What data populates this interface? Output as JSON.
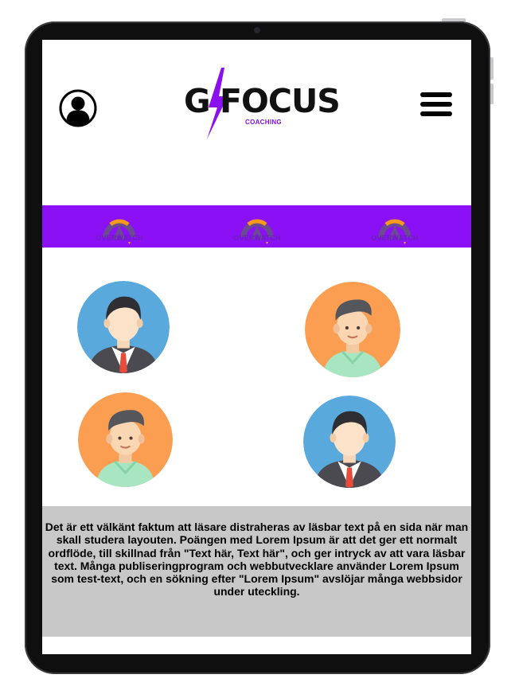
{
  "brand": {
    "logo_left": "G",
    "logo_right": "FOCUS",
    "logo_sub": "COACHING",
    "accent_color": "#8b10f5",
    "bolt_color": "#8a10f0"
  },
  "header": {
    "profile_icon": "user-circle-icon",
    "menu_icon": "hamburger-menu-icon"
  },
  "banner": {
    "color": "#8b10f5",
    "badges": [
      {
        "label": "OVERWATCH",
        "icon": "overwatch-logo-icon"
      },
      {
        "label": "OVERWATCH",
        "icon": "overwatch-logo-icon"
      },
      {
        "label": "OVERWATCH",
        "icon": "overwatch-logo-icon"
      }
    ]
  },
  "coaches": [
    {
      "style": "businessman",
      "background": "#5aa9dc"
    },
    {
      "style": "casual-man",
      "background": "#fb9e52"
    },
    {
      "style": "casual-man",
      "background": "#fb9e52"
    },
    {
      "style": "businessman",
      "background": "#5aa9dc"
    }
  ],
  "info": {
    "text": "Det är ett välkänt faktum att läsare distraheras av läsbar text på en sida när man skall studera layouten. Poängen med Lorem Ipsum är att det ger ett normalt ordflöde, till skillnad från \"Text här, Text här\", och ger intryck av att vara läsbar text. Många publiseringprogram och webbutvecklare använder Lorem Ipsum som test-text, och en sökning efter \"Lorem Ipsum\" avslöjar många webbsidor under uteckling.",
    "background": "#c8c8c8"
  }
}
